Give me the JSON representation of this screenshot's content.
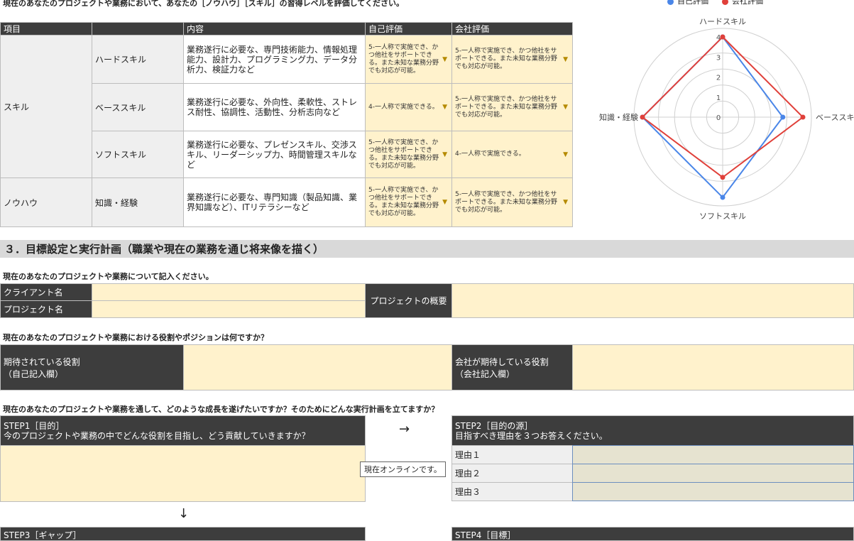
{
  "intro_text": "現在のあなたのプロジェクトや業務において、あなたの［ノウハウ］［スキル］の習得レベルを評価してください。",
  "table": {
    "headers": [
      "項目",
      "",
      "内容",
      "自己評価",
      "会社評価"
    ],
    "group_skill": "スキル",
    "group_knowhow": "ノウハウ",
    "rows": [
      {
        "sub": "ハードスキル",
        "content": "業務遂行に必要な、専門技術能力、情報処理能力、設計力、プログラミング力、データ分析力、検証力など",
        "self": "5-一人称で実施でき、かつ他社をサポートできる。また未知な業務分野でも対応が可能。",
        "company": "5-一人称で実施でき、かつ他社をサポートできる。また未知な業務分野でも対応が可能。"
      },
      {
        "sub": "ベーススキル",
        "content": "業務遂行に必要な、外向性、柔軟性、ストレス耐性、協調性、活動性、分析志向など",
        "self": "4-一人称で実施できる。",
        "company": "5-一人称で実施でき、かつ他社をサポートできる。また未知な業務分野でも対応が可能。"
      },
      {
        "sub": "ソフトスキル",
        "content": "業務遂行に必要な、プレゼンスキル、交渉スキル、リーダーシップ力、時間管理スキルなど",
        "self": "5-一人称で実施でき、かつ他社をサポートできる。また未知な業務分野でも対応が可能。",
        "company": "4-一人称で実施できる。"
      },
      {
        "sub": "知識・経験",
        "content": "業務遂行に必要な、専門知識（製品知識、業界知識など）、ITリテラシーなど",
        "self": "5-一人称で実施でき、かつ他社をサポートできる。また未知な業務分野でも対応が可能。",
        "company": "5-一人称で実施でき、かつ他社をサポートできる。また未知な業務分野でも対応が可能。"
      }
    ]
  },
  "chart_data": {
    "type": "radar",
    "axes": [
      "ハードスキル",
      "ベーススキル",
      "ソフトスキル",
      "知識・経験"
    ],
    "rmin": 0,
    "rmax": 4,
    "ticks": [
      "0",
      "1",
      "2",
      "3",
      "4"
    ],
    "series": [
      {
        "name": "自己評価",
        "color": "#4a86e8",
        "values": [
          4,
          3,
          4,
          4
        ]
      },
      {
        "name": "会社評価",
        "color": "#e0403a",
        "values": [
          4,
          4,
          3,
          4
        ]
      }
    ],
    "legend_position": "top"
  },
  "section3": {
    "title": "３．目標設定と実行計画（職業や現在の業務を通じ将来像を描く）",
    "q1": "現在のあなたのプロジェクトや業務について記入ください。",
    "client_label": "クライアント名",
    "project_label": "プロジェクト名",
    "overview_label": "プロジェクトの概要",
    "q2": "現在のあなたのプロジェクトや業務における役割やポジションは何ですか？",
    "expected_role_label": "期待されている役割",
    "expected_role_sub": "（自己記入欄）",
    "company_role_label": "会社が期待している役割",
    "company_role_sub": "（会社記入欄）",
    "q3": "現在のあなたのプロジェクトや業務を通して、どのような成長を遂げたいですか？そのためにどんな実行計画を立てますか？",
    "step1_title": "STEP1［目的］",
    "step1_desc": "今のプロジェクトや業務の中でどんな役割を目指し、どう貢献していきますか？",
    "arrow_right": "→",
    "arrow_down": "↓",
    "step2_title": "STEP2［目的の源］",
    "step2_desc": "目指すべき理由を３つお答えください。",
    "reasons": [
      "理由１",
      "理由２",
      "理由３"
    ],
    "step3_title": "STEP3［ギャップ］",
    "step4_title": "STEP4［目標］",
    "tooltip": "現在オンラインです。"
  }
}
